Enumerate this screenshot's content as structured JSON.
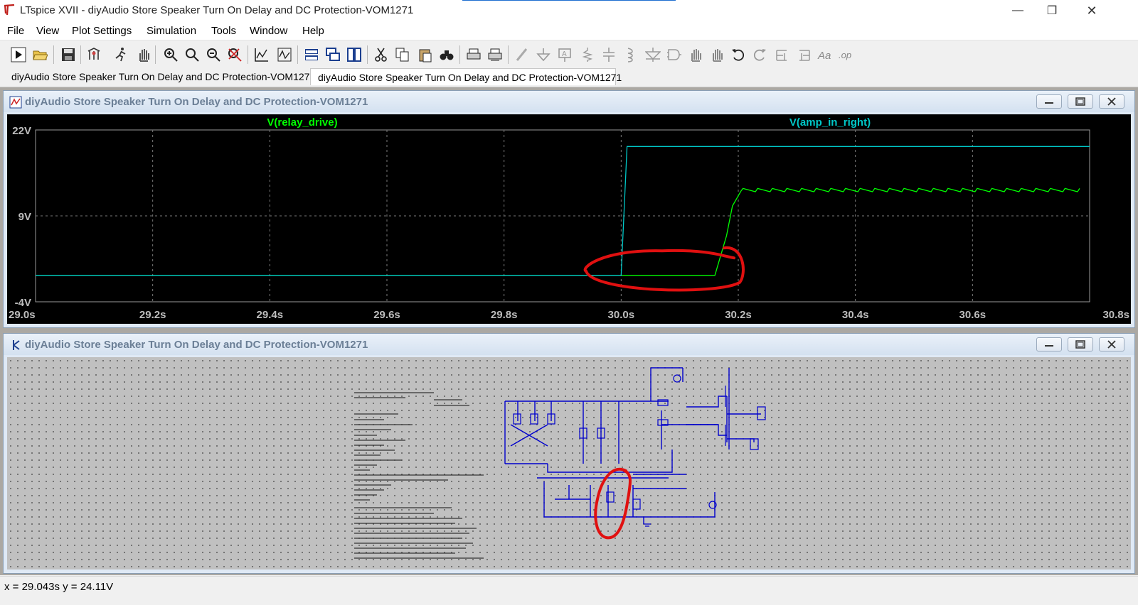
{
  "window": {
    "title": "LTspice XVII - diyAudio Store Speaker Turn On Delay and DC Protection-VOM1271",
    "controls": {
      "minimize": "—",
      "restore": "❐",
      "close": "✕"
    }
  },
  "menu": [
    "File",
    "View",
    "Plot Settings",
    "Simulation",
    "Tools",
    "Window",
    "Help"
  ],
  "toolbar_icons": [
    "run-icon",
    "open-icon",
    "save-icon",
    "control-panel-icon",
    "run-sim-icon",
    "pan-icon",
    "zoom-in-icon",
    "zoom-area-icon",
    "zoom-out-icon",
    "zoom-cancel-icon",
    "autorange-icon",
    "waveform-icon",
    "tile-horizontal-icon",
    "cascade-icon",
    "tile-vertical-icon",
    "cut-icon",
    "copy-icon",
    "paste-icon",
    "find-icon",
    "print-icon",
    "print-setup-icon",
    "wire-icon",
    "ground-icon",
    "label-icon",
    "resistor-icon",
    "capacitor-icon",
    "inductor-icon",
    "diode-icon",
    "component-icon",
    "move-icon",
    "drag-icon",
    "undo-icon",
    "redo-icon",
    "rotate-icon",
    "mirror-icon",
    "text-icon",
    "spice-directive-icon"
  ],
  "tabs": [
    {
      "label": "diyAudio Store Speaker Turn On Delay and DC Protection-VOM1271",
      "kind": "schematic"
    },
    {
      "label": "diyAudio Store Speaker Turn On Delay and DC Protection-VOM1271",
      "kind": "waveform"
    }
  ],
  "waveform_window": {
    "title": "diyAudio Store Speaker Turn On Delay and DC Protection-VOM1271"
  },
  "schematic_window": {
    "title": "diyAudio Store Speaker Turn On Delay and DC Protection-VOM1271"
  },
  "chart_data": {
    "type": "line",
    "title": "",
    "xlabel": "",
    "ylabel": "",
    "xlim": [
      29.0,
      30.8
    ],
    "ylim": [
      -4,
      22
    ],
    "x_ticks": [
      "29.0s",
      "29.2s",
      "29.4s",
      "29.6s",
      "29.8s",
      "30.0s",
      "30.2s",
      "30.4s",
      "30.6s",
      "30.8s"
    ],
    "y_ticks": [
      "22V",
      "9V",
      "-4V"
    ],
    "grid": true,
    "legend_placement": "top",
    "series": [
      {
        "name": "V(relay_drive)",
        "color": "#00ff00",
        "points": [
          [
            29.0,
            0
          ],
          [
            30.16,
            0
          ],
          [
            30.18,
            6
          ],
          [
            30.19,
            10.5
          ],
          [
            30.205,
            12.8
          ],
          [
            30.25,
            12.9
          ],
          [
            30.4,
            12.9
          ],
          [
            30.6,
            12.9
          ],
          [
            30.8,
            12.9
          ]
        ],
        "ripple": {
          "start": 30.2,
          "amplitude_v": 0.5,
          "period_s": 0.025
        }
      },
      {
        "name": "V(amp_in_right)",
        "color": "#00c8c8",
        "points": [
          [
            29.0,
            0
          ],
          [
            30.0,
            0
          ],
          [
            30.01,
            19.5
          ],
          [
            30.8,
            19.5
          ]
        ]
      }
    ],
    "annotations": [
      {
        "type": "hand-drawn-ellipse",
        "color": "#e01010",
        "around_x": [
          29.94,
          30.2
        ],
        "around_y": [
          -1.5,
          3.5
        ]
      }
    ]
  },
  "status": {
    "text": "x = 29.043s    y = 24.11V"
  },
  "colors": {
    "plot_bg": "#000000",
    "grid": "#7a7a7a",
    "schematic_wire": "#0000cc",
    "annotation": "#e01010"
  }
}
